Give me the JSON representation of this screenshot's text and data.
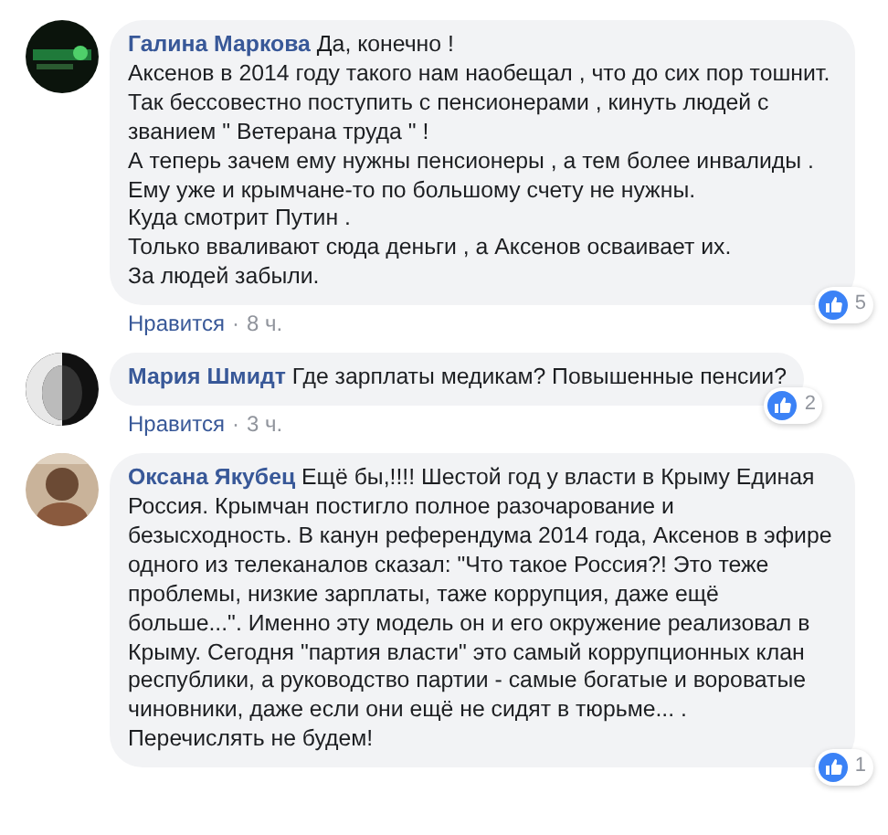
{
  "comments": [
    {
      "author": "Галина Маркова",
      "paragraphs": [
        "Да, конечно !",
        "Аксенов в 2014 году такого нам наобещал , что до сих пор тошнит.",
        "Так бессовестно поступить с пенсионерами , кинуть людей с званием \" Ветерана труда \" !",
        "А теперь зачем ему нужны пенсионеры , а тем более инвалиды .",
        "Ему уже и крымчане-то по большому счету не нужны.",
        "Куда смотрит Путин .",
        "Только вваливают сюда деньги , а Аксенов осваивает их.",
        "За людей забыли."
      ],
      "like_label": "Нравится",
      "separator": "·",
      "time": "8 ч.",
      "reactions": "5",
      "avatar": {
        "kind": "picture"
      }
    },
    {
      "author": "Мария Шмидт",
      "paragraphs": [
        "Где зарплаты медикам? Повышенные пенсии?"
      ],
      "like_label": "Нравится",
      "separator": "·",
      "time": "3 ч.",
      "reactions": "2",
      "avatar": {
        "kind": "picture"
      }
    },
    {
      "author": "Оксана Якубец",
      "paragraphs": [
        "Ещё бы,!!!! Шестой год у власти в Крыму Единая Россия. Крымчан постигло полное разочарование и безысходность. В канун референдума 2014 года, Аксенов в эфире одного из телеканалов сказал: \"Что такое Россия?! Это теже проблемы, низкие зарплаты, таже коррупция, даже ещё больше...\". Именно эту модель он и его окружение реализовал в Крыму. Сегодня \"партия власти\" это самый коррупционных клан республики, а руководство партии - самые богатые и вороватые чиновники, даже если они ещё не сидят в тюрьме... .",
        "Перечислять не будем!"
      ],
      "reactions": "1",
      "avatar": {
        "kind": "picture"
      }
    }
  ]
}
